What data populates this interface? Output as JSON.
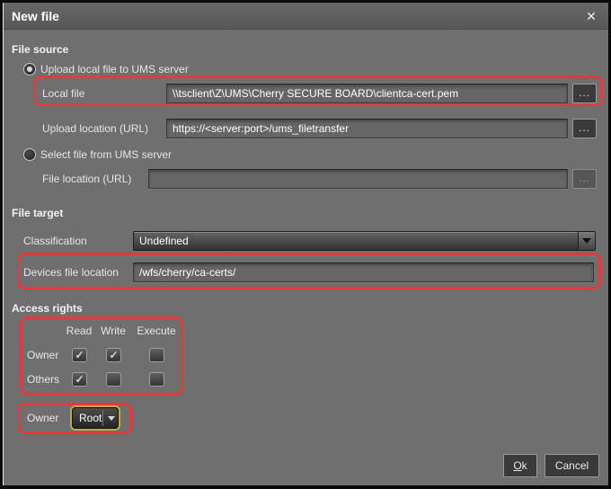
{
  "window": {
    "title": "New file"
  },
  "glyphs": {
    "close": "✕",
    "check": "✓",
    "browse": "..."
  },
  "colors": {
    "annotation_red": "#e23b3b",
    "focus_yellow": "#c7a843",
    "dialog_bg": "#6f6f6f",
    "control_bg": "#3a3a3a"
  },
  "file_source": {
    "section_label": "File source",
    "upload_radio_label": "Upload local file to UMS server",
    "local_file_label": "Local file",
    "local_file_value": "\\\\tsclient\\Z\\UMS\\Cherry SECURE BOARD\\clientca-cert.pem",
    "upload_location_label": "Upload location (URL)",
    "upload_location_value": "https://<server:port>/ums_filetransfer",
    "select_radio_label": "Select file from UMS server",
    "file_location_label": "File location (URL)",
    "file_location_value": ""
  },
  "file_target": {
    "section_label": "File target",
    "classification_label": "Classification",
    "classification_value": "Undefined",
    "devices_location_label": "Devices file location",
    "devices_location_value": "/wfs/cherry/ca-certs/"
  },
  "access_rights": {
    "section_label": "Access rights",
    "columns": [
      "Read",
      "Write",
      "Execute"
    ],
    "rows": [
      {
        "label": "Owner",
        "read": true,
        "write": true,
        "execute": false
      },
      {
        "label": "Others",
        "read": true,
        "write": false,
        "execute": false
      }
    ],
    "owner_label": "Owner",
    "owner_value": "Root"
  },
  "footer": {
    "ok_label": "Ok",
    "cancel_label": "Cancel"
  }
}
